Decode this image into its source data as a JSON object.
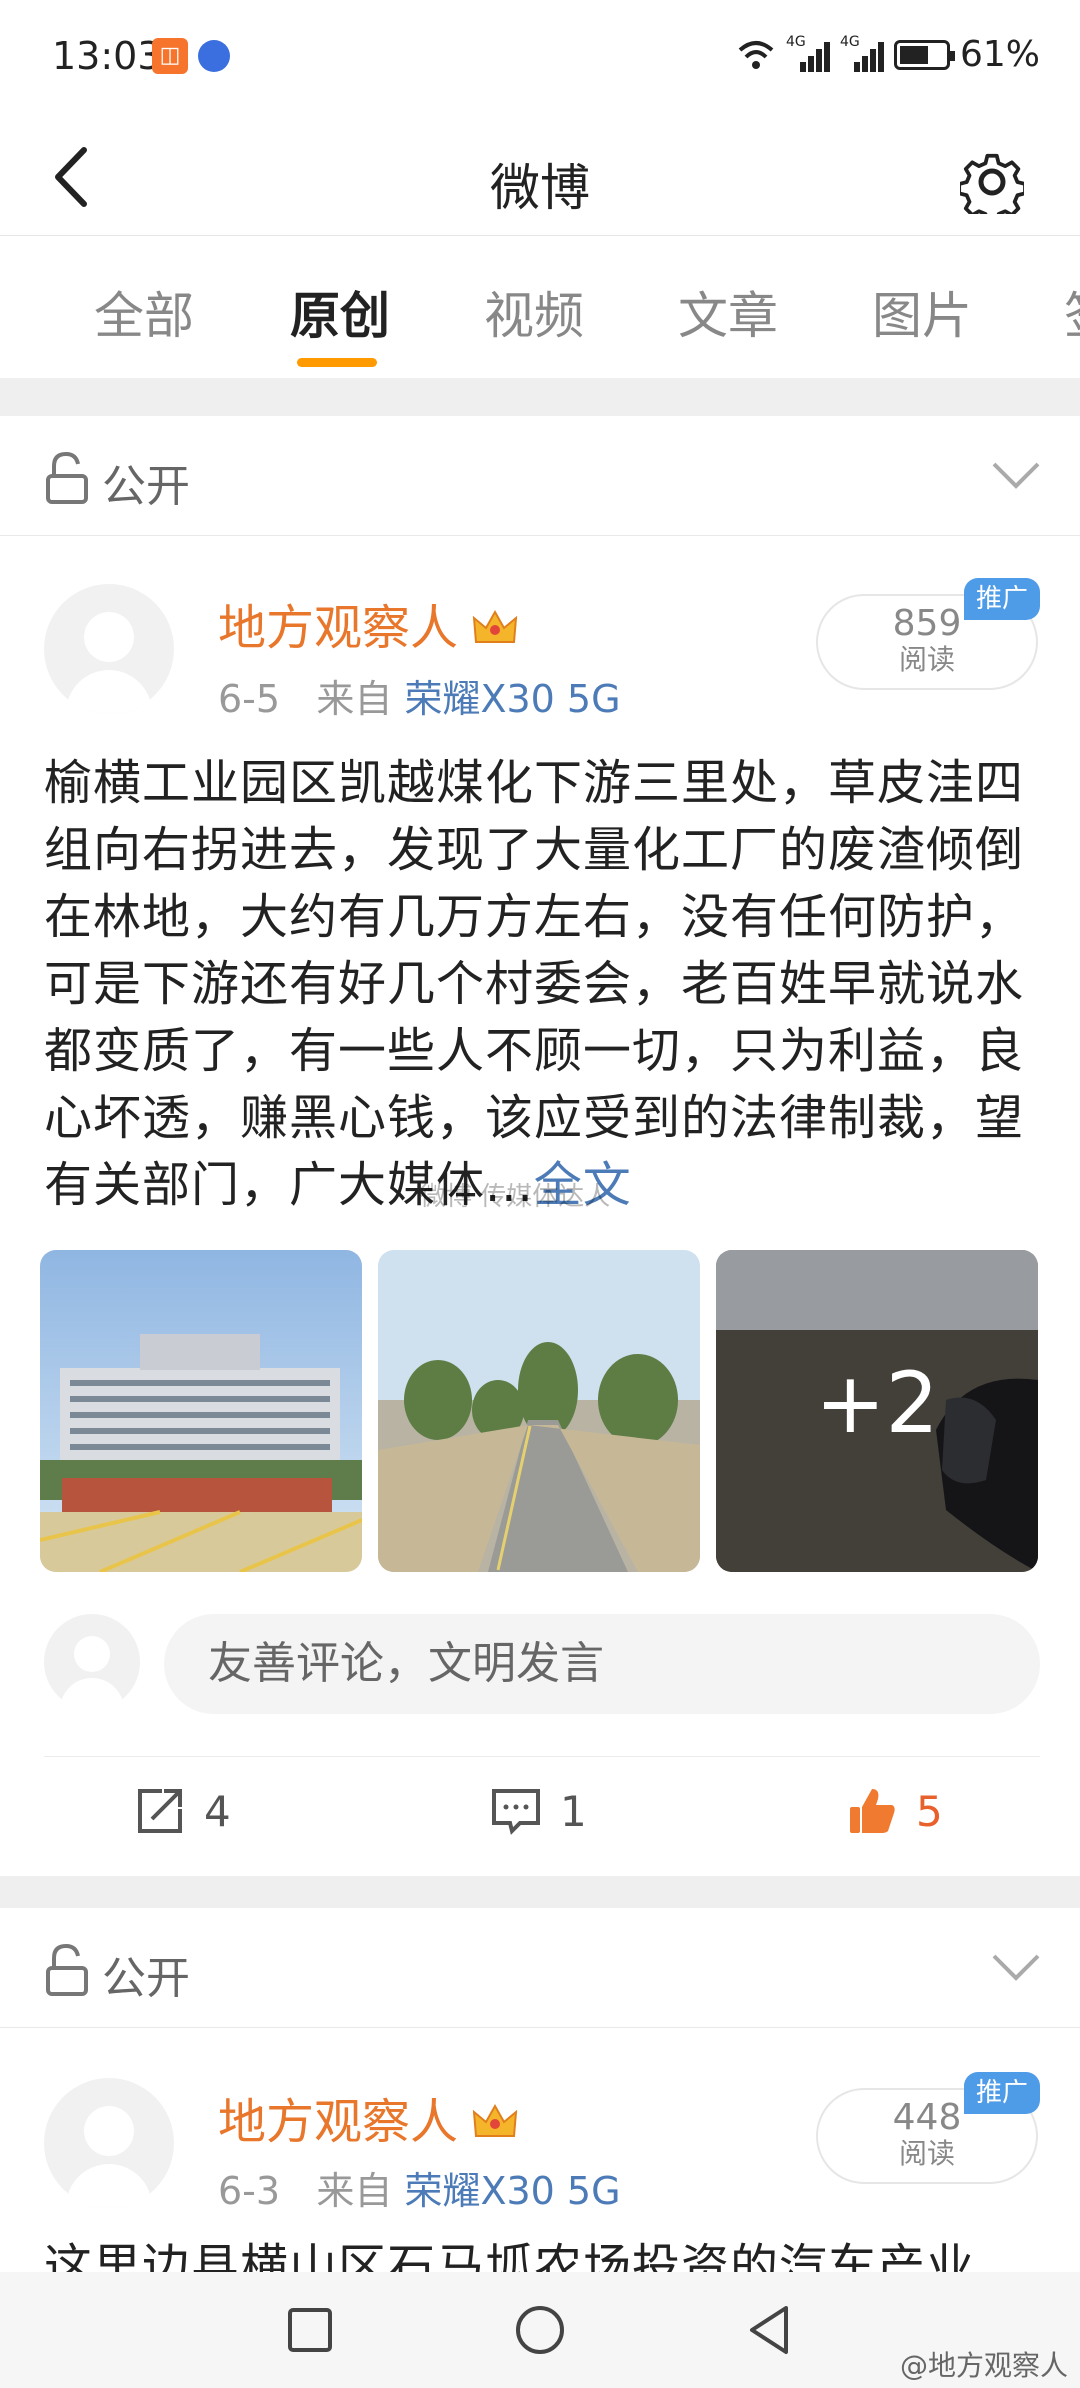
{
  "status_bar": {
    "time": "13:03",
    "net1": "4G",
    "net2": "4G",
    "battery": "61%"
  },
  "nav": {
    "title": "微博"
  },
  "tabs": [
    {
      "label": "全部",
      "active": false
    },
    {
      "label": "原创",
      "active": true
    },
    {
      "label": "视频",
      "active": false
    },
    {
      "label": "文章",
      "active": false
    },
    {
      "label": "图片",
      "active": false
    },
    {
      "label": "签",
      "active": false
    }
  ],
  "posts": [
    {
      "visibility": "公开",
      "author": "地方观察人",
      "date": "6-5",
      "source_prefix": "来自",
      "device": "荣耀X30 5G",
      "reads": "859",
      "reads_label": "阅读",
      "promo": "推广",
      "text": "榆横工业园区凯越煤化下游三里处，草皮洼四组向右拐进去，发现了大量化工厂的废渣倾倒在林地，大约有几万方左右，没有任何防护，可是下游还有好几个村委会，老百姓早就说水都变质了，有一些人不顾一切，只为利益，良心坏透，赚黑心钱，该应受到的法律制裁，望有关部门，广大媒体...",
      "more": "全文",
      "images_more": "+2",
      "comment_placeholder": "友善评论，文明发言",
      "repost_count": "4",
      "comment_count": "1",
      "like_count": "5"
    },
    {
      "visibility": "公开",
      "author": "地方观察人",
      "date": "6-3",
      "source_prefix": "来自",
      "device": "荣耀X30 5G",
      "reads": "448",
      "reads_label": "阅读",
      "promo": "推广",
      "text": "这里边县横山区石马坬农场投资的汽车产业"
    }
  ],
  "watermarks": {
    "overlay": "微博 传媒体达人",
    "corner": "@地方观察人"
  }
}
